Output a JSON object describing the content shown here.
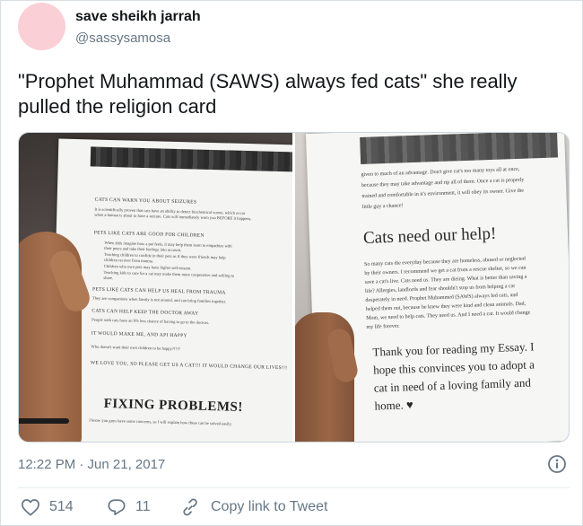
{
  "user": {
    "display_name": "save sheikh jarrah",
    "handle": "@sassysamosa",
    "avatar_color": "#fbcfd6"
  },
  "tweet": {
    "text": "\"Prophet Muhammad (SAWS) always fed cats\" she really pulled the religion card",
    "timestamp": "12:22 PM · Jun 21, 2017",
    "info_icon": "info-icon"
  },
  "photos": {
    "left": {
      "heading_1": "CATS CAN WARN YOU ABOUT SEIZURES",
      "para_1a": "It is scientifically proven that cats have an ability to detect biochemical scents, which occur",
      "para_1b": "when a human is about to have a seizure. Cats will immediately warn you BEFORE it happens.",
      "heading_2": "PETS LIKE CATS ARE GOOD FOR CHILDREN",
      "bullet_1a": "When kids imagine how a pet feels, it may help them learn to empathize with",
      "bullet_1b": "their peers and take their feelings into account.",
      "bullet_2a": "Teaching children to confide in their pets as if they were friends may help",
      "bullet_2b": "children recover from trauma.",
      "bullet_3": "Children who own pets may have higher self-esteem.",
      "bullet_4a": "Teaching kids to care for a cat may make them more cooperative and willing to",
      "bullet_4b": "share.",
      "heading_3": "PETS LIKE CATS CAN HELP US HEAL FROM TRAUMA",
      "para_3": "They are companions when family is not around, and can bring families together.",
      "heading_4": "CATS CAN HELP KEEP THE DOCTOR AWAY",
      "para_4": "People with cats have an 8% less chance of having to go to the doctors.",
      "heading_5": "IT WOULD MAKE ME, AND API HAPPY",
      "para_5": "Who doesn't want their own children to be happy?!?!?",
      "heading_6": "WE LOVE YOU, SO PLEASE GET US A CAT!!! IT WOULD CHANGE OUR LIVES!!!",
      "fixing_title": "FIXING PROBLEMS!",
      "fixing_sub": "I know you guys have some concerns, so I will explain how these can be solved easily."
    },
    "right": {
      "top_1": "given to much of an advantage. Don't give cat's too many toys all at once,",
      "top_2": "because they may take advantage and rip all of them. Once a cat is properly",
      "top_3": "trained and comfortable in it's environment, it will obey its owner. Give the",
      "top_4": "little guy a chance!",
      "title": "Cats need our help!",
      "body_1": "So many cats die everyday because they are homeless, abused or neglected",
      "body_2": "by their owners. I recommend we get a cat from a rescue shelter, so we can",
      "body_3": "save a cat's live. Cats need us. They are dieing. What is better than saving a",
      "body_4": "life? Allergies, landlords and fear shouldn't stop us from helping a cat",
      "body_5": "desperately in need. Prophet Muhammed (SAWS) always fed cats, and",
      "body_6": "helped them out, because he knew they were kind and clean animals. Dad,",
      "body_7": "Mom, we need to help cats. They need us. And I need a cat. It would change",
      "body_8": "my life forever.",
      "thanks_1": "Thank you for reading my Essay. I",
      "thanks_2": "hope this convinces you to adopt a",
      "thanks_3": "cat in need of a loving family and",
      "thanks_4": "home. ♥"
    }
  },
  "actions": {
    "like_count": "514",
    "reply_count": "11",
    "copy_label": "Copy link to Tweet",
    "like_icon": "heart-icon",
    "reply_icon": "reply-icon",
    "copy_icon": "link-icon"
  }
}
